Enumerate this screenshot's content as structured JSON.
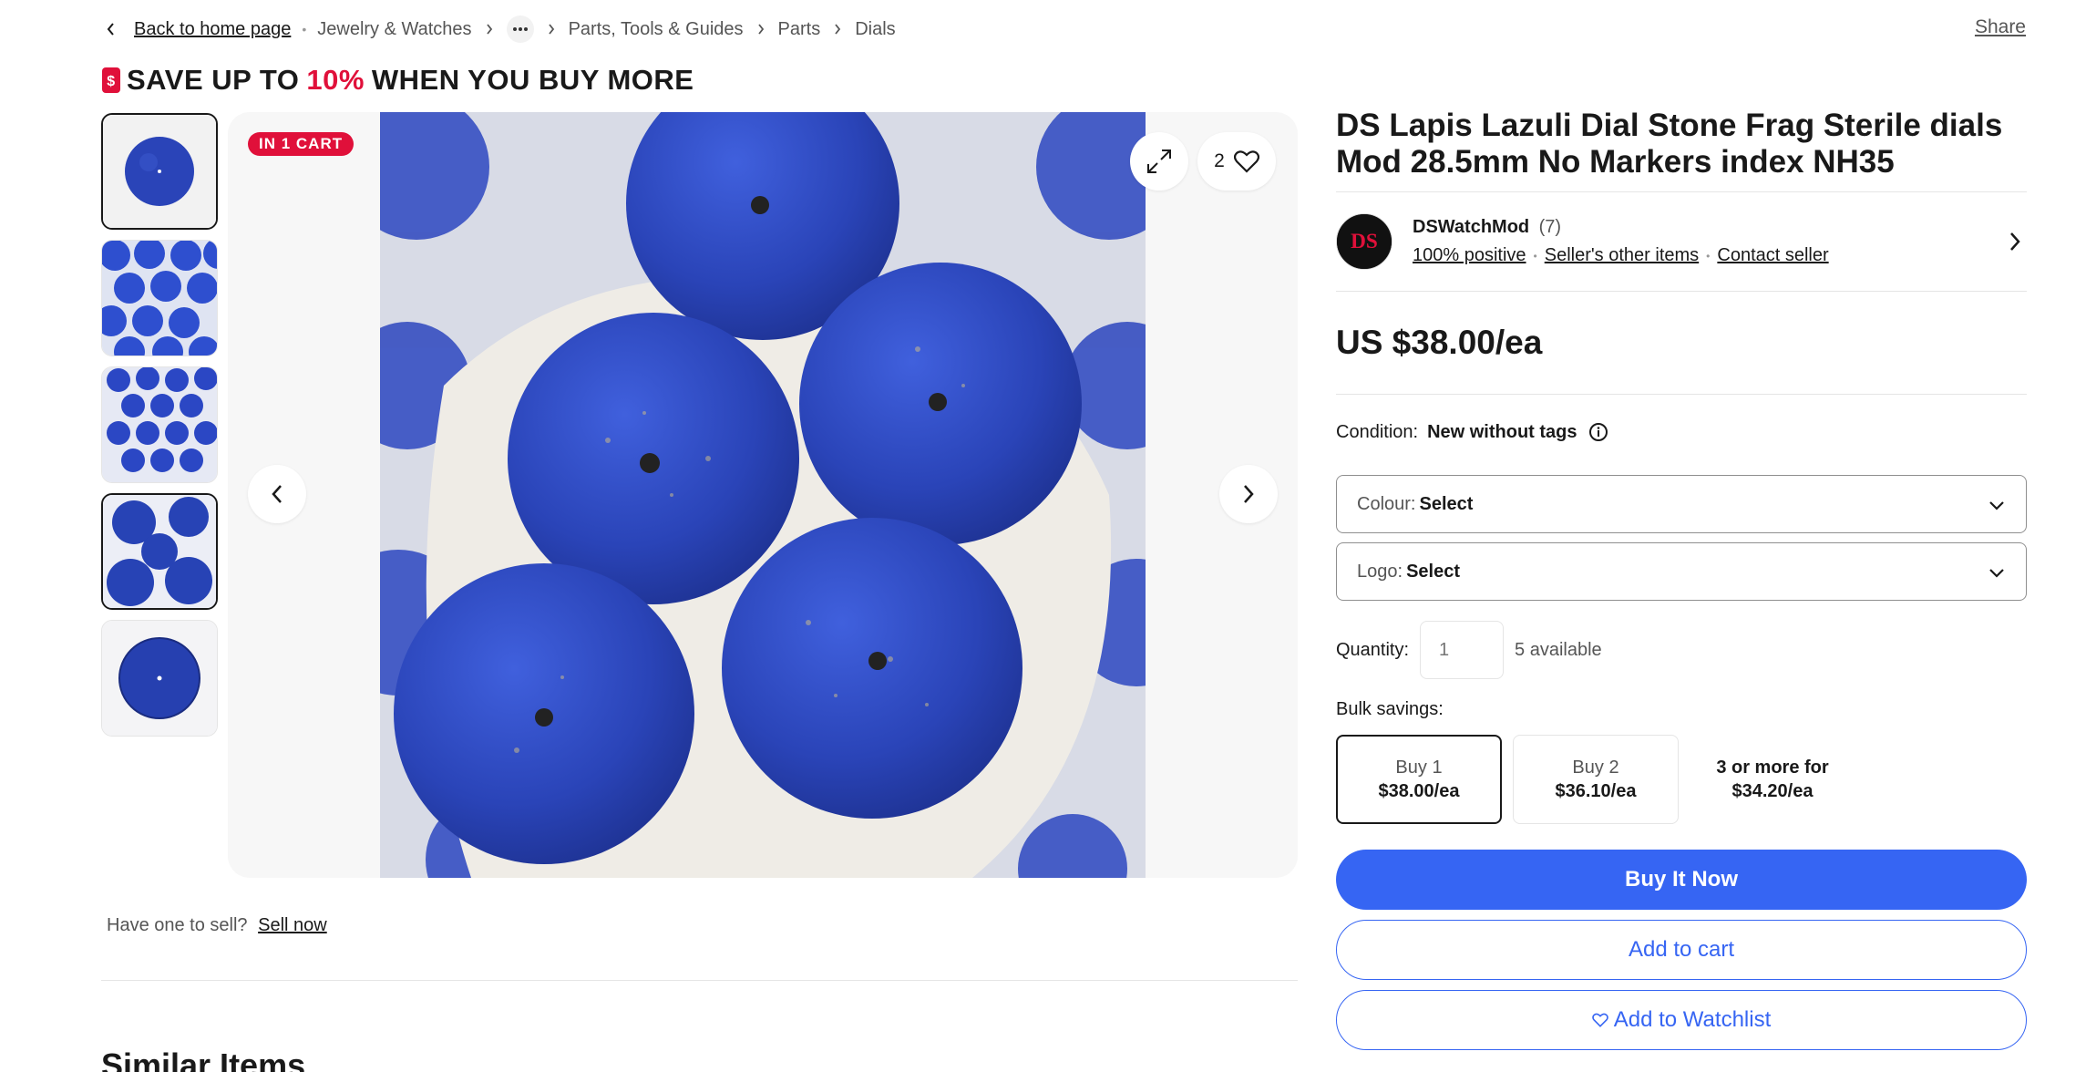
{
  "breadcrumb": {
    "back": "Back to home page",
    "items": [
      "Jewelry & Watches",
      "Parts, Tools & Guides",
      "Parts",
      "Dials"
    ]
  },
  "share": "Share",
  "promo": {
    "pre": "SAVE UP TO",
    "accent": "10%",
    "post": "WHEN YOU BUY MORE"
  },
  "gallery": {
    "cart_badge": "IN 1 CART",
    "watch_count": "2",
    "selected_thumbnail": 1
  },
  "sell": {
    "text": "Have one to sell?",
    "link": "Sell now"
  },
  "similar_heading": "Similar Items",
  "item": {
    "title": "DS Lapis Lazuli Dial Stone Frag Sterile dials Mod 28.5mm No Markers index NH35"
  },
  "seller": {
    "name": "DSWatchMod",
    "count": "(7)",
    "feedback": "100% positive",
    "other_items": "Seller's other items",
    "contact": "Contact seller"
  },
  "price": "US $38.00/ea",
  "condition": {
    "label": "Condition:",
    "value": "New without tags"
  },
  "selects": [
    {
      "label": "Colour:",
      "value": "Select"
    },
    {
      "label": "Logo:",
      "value": "Select"
    }
  ],
  "quantity": {
    "label": "Quantity:",
    "placeholder": "1",
    "available": "5 available"
  },
  "bulk": {
    "label": "Bulk savings:",
    "options": [
      {
        "top": "Buy 1",
        "bottom": "$38.00/ea"
      },
      {
        "top": "Buy 2",
        "bottom": "$36.10/ea"
      },
      {
        "top": "3 or more for",
        "bottom": "$34.20/ea"
      }
    ]
  },
  "buttons": {
    "buy": "Buy It Now",
    "cart": "Add to cart",
    "watch": "Add to Watchlist"
  },
  "colors": {
    "primary": "#3665f3",
    "accent": "#e0103a",
    "lapis": "#2a44b8"
  }
}
